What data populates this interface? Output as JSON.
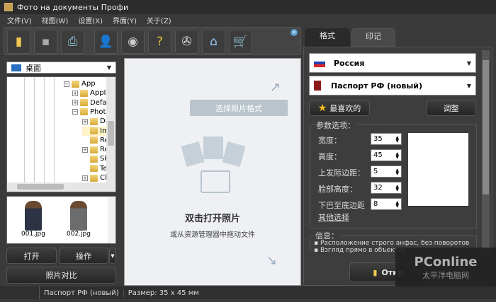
{
  "window": {
    "title": "Фото на документы Профи"
  },
  "menu": [
    "文件(V)",
    "视图(W)",
    "设置(X)",
    "界面(Y)",
    "关于(Z)"
  ],
  "toolbar": [
    {
      "icon": "open-folder-icon"
    },
    {
      "icon": "save-icon"
    },
    {
      "icon": "print-icon"
    },
    {
      "icon": "user-icon"
    },
    {
      "icon": "camera-icon"
    },
    {
      "icon": "help-book-icon"
    },
    {
      "icon": "video-reel-icon"
    },
    {
      "icon": "home-icon"
    },
    {
      "icon": "cart-icon"
    }
  ],
  "left": {
    "location": "桌面",
    "tree": [
      {
        "label": "App",
        "exp": "−"
      },
      {
        "label": "AppIn",
        "exp": "+"
      },
      {
        "label": "Defau",
        "exp": "+"
      },
      {
        "label": "Photo",
        "exp": "−"
      },
      {
        "label": "Da",
        "exp": "+"
      },
      {
        "label": "Im",
        "exp": ""
      },
      {
        "label": "Re",
        "exp": ""
      },
      {
        "label": "Re",
        "exp": "+"
      },
      {
        "label": "Sk",
        "exp": ""
      },
      {
        "label": "Te",
        "exp": ""
      },
      {
        "label": "Cl",
        "exp": "+"
      }
    ],
    "thumbs": [
      "001.jpg",
      "002.jpg"
    ],
    "open": "打开",
    "operate": "操作",
    "compare": "照片对比"
  },
  "center": {
    "choose_format": "选择照片格式",
    "dbl_click": "双击打开照片",
    "drag_hint": "或从资源管理器中拖动文件"
  },
  "right": {
    "tabs": [
      "格式",
      "印记"
    ],
    "country": "Россия",
    "doc": "Паспорт РФ (новый)",
    "favorites": "最喜欢的",
    "adjust": "调整",
    "params_title": "参数选项：",
    "params": [
      {
        "label": "宽度：",
        "value": "35"
      },
      {
        "label": "高度：",
        "value": "45"
      },
      {
        "label": "上发际边距：",
        "value": "5"
      },
      {
        "label": "脸部高度：",
        "value": "32"
      },
      {
        "label": "下巴至底边距",
        "value": "8"
      }
    ],
    "more": "其他选择",
    "info_title": "信息：",
    "info": [
      "Расположение строго анфас, без поворотов",
      "Взгляд прямо в объектив"
    ],
    "open_btn": "Откр"
  },
  "status": {
    "doc": "Паспорт РФ (новый)",
    "size": "Размер: 35 x 45 мм"
  },
  "watermark": {
    "brand": "PConline",
    "sub": "太平洋电脑网"
  }
}
